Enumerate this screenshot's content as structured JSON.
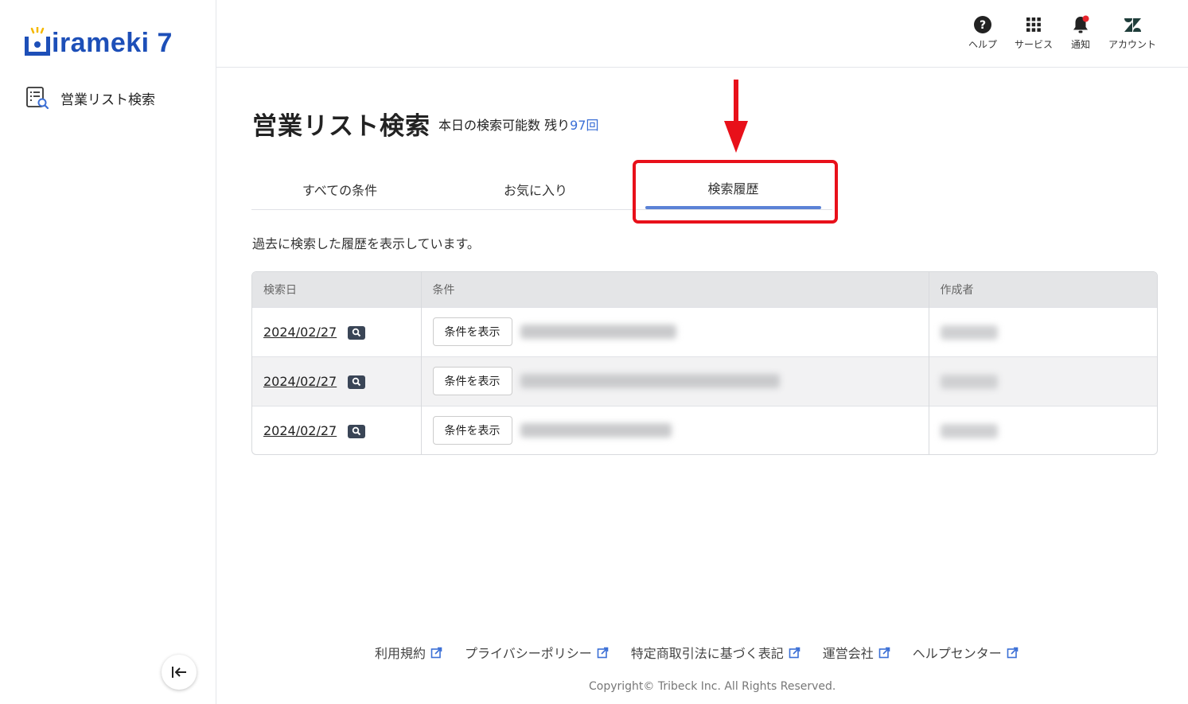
{
  "app": {
    "logo_text": "Hirameki 7",
    "logo_display": "irameki 7",
    "brand_color": "#1d4fb8"
  },
  "sidebar": {
    "items": [
      {
        "label": "営業リスト検索",
        "icon": "list-search-icon"
      }
    ],
    "collapse_icon": "collapse-left-icon"
  },
  "topbar": {
    "items": [
      {
        "label": "ヘルプ",
        "icon": "help-icon"
      },
      {
        "label": "サービス",
        "icon": "grid-icon"
      },
      {
        "label": "通知",
        "icon": "bell-icon"
      },
      {
        "label": "アカウント",
        "icon": "zendesk-icon"
      }
    ]
  },
  "main": {
    "title": "営業リスト検索",
    "quota_prefix": "本日の検索可能数 残り",
    "quota_value": "97回",
    "tabs": [
      {
        "label": "すべての条件",
        "active": false
      },
      {
        "label": "お気に入り",
        "active": false
      },
      {
        "label": "検索履歴",
        "active": true
      }
    ],
    "description": "過去に検索した履歴を表示しています。",
    "table": {
      "headers": [
        "検索日",
        "条件",
        "作成者"
      ],
      "rows": [
        {
          "date": "2024/02/27",
          "button": "条件を表示"
        },
        {
          "date": "2024/02/27",
          "button": "条件を表示"
        },
        {
          "date": "2024/02/27",
          "button": "条件を表示"
        }
      ]
    }
  },
  "footer": {
    "links": [
      "利用規約",
      "プライバシーポリシー",
      "特定商取引法に基づく表記",
      "運営会社",
      "ヘルプセンター"
    ],
    "copyright": "Copyright© Tribeck Inc. All Rights Reserved."
  },
  "colors": {
    "accent": "#3b6fd6",
    "highlight": "#e8101a",
    "tab_indicator": "#5b82d6"
  }
}
